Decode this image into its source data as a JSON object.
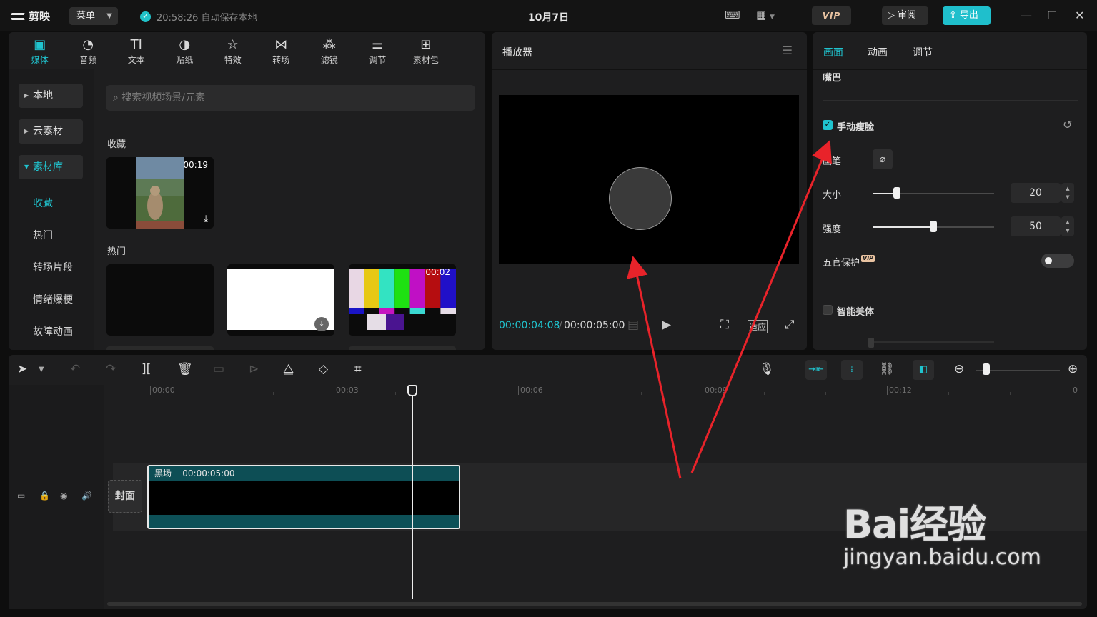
{
  "app": {
    "logo_text": "剪映",
    "menu_label": "菜单",
    "autosave_text": "20:58:26 自动保存本地",
    "project_title": "10月7日",
    "vip_label": "VIP",
    "review_label": "审阅",
    "export_label": "导出",
    "accent_color": "#20c4cf"
  },
  "media": {
    "tabs": [
      {
        "label": "媒体",
        "icon": "media-icon"
      },
      {
        "label": "音频",
        "icon": "audio-icon"
      },
      {
        "label": "文本",
        "icon": "text-icon"
      },
      {
        "label": "贴纸",
        "icon": "sticker-icon"
      },
      {
        "label": "特效",
        "icon": "effects-icon"
      },
      {
        "label": "转场",
        "icon": "transition-icon"
      },
      {
        "label": "滤镜",
        "icon": "filter-icon"
      },
      {
        "label": "调节",
        "icon": "adjust-icon"
      },
      {
        "label": "素材包",
        "icon": "package-icon"
      }
    ],
    "sidebar": {
      "local": "本地",
      "cloud": "云素材",
      "library": "素材库",
      "subs": [
        "收藏",
        "热门",
        "转场片段",
        "情绪爆梗",
        "故障动画"
      ]
    },
    "search_placeholder": "搜索视频场景/元素",
    "favorites_label": "收藏",
    "favorite_duration": "00:19",
    "hot_label": "热门",
    "hot_duration": "00:02"
  },
  "player": {
    "title": "播放器",
    "current_time": "00:00:04:08",
    "separator": "/",
    "total_time": "00:00:05:00",
    "fit_label": "适应"
  },
  "inspector": {
    "tabs": [
      "画面",
      "动画",
      "调节"
    ],
    "section_top": "嘴巴",
    "manual_slim": "手动瘦脸",
    "brush_label": "画笔",
    "size_label": "大小",
    "size_value": "20",
    "size_level": 0.2,
    "strength_label": "强度",
    "strength_value": "50",
    "strength_level": 0.5,
    "protect_label": "五官保护",
    "smart_body": "智能美体"
  },
  "timeline": {
    "ruler_labels": [
      "00:00",
      "00:03",
      "00:06",
      "00:09",
      "00:12",
      "0"
    ],
    "cover_label": "封面",
    "clip_name": "黑场",
    "clip_duration": "00:00:05:00"
  },
  "watermark": {
    "main": "Bai经验",
    "sub": "jingyan.baidu.com"
  }
}
